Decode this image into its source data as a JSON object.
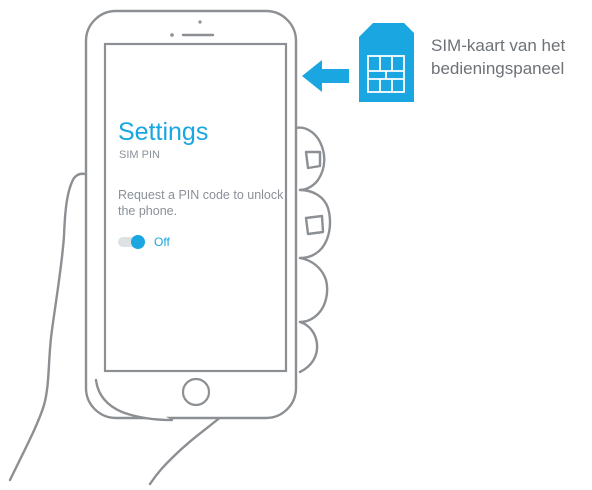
{
  "screen": {
    "title": "Settings",
    "subtitle": "SIM PIN",
    "description": "Request a PIN code to unlock the phone.",
    "toggle_state": "Off",
    "pin_request_enabled": false
  },
  "sim_card": {
    "caption_line1": "SIM-kaart van het",
    "caption_line2": "bedieningspaneel"
  },
  "icons": {
    "phone": "smartphone-icon",
    "hand": "hand-icon",
    "sim": "sim-card-icon",
    "arrow": "arrow-left-icon",
    "home": "home-button-icon"
  },
  "colors": {
    "accent": "#1aa6e0",
    "title": "#1aa6e0",
    "body_text": "#8a9198",
    "outline": "#8c8f93",
    "caption": "#6d7277",
    "sim_card": "#1aa6e0",
    "arrow": "#1aa6e0"
  }
}
